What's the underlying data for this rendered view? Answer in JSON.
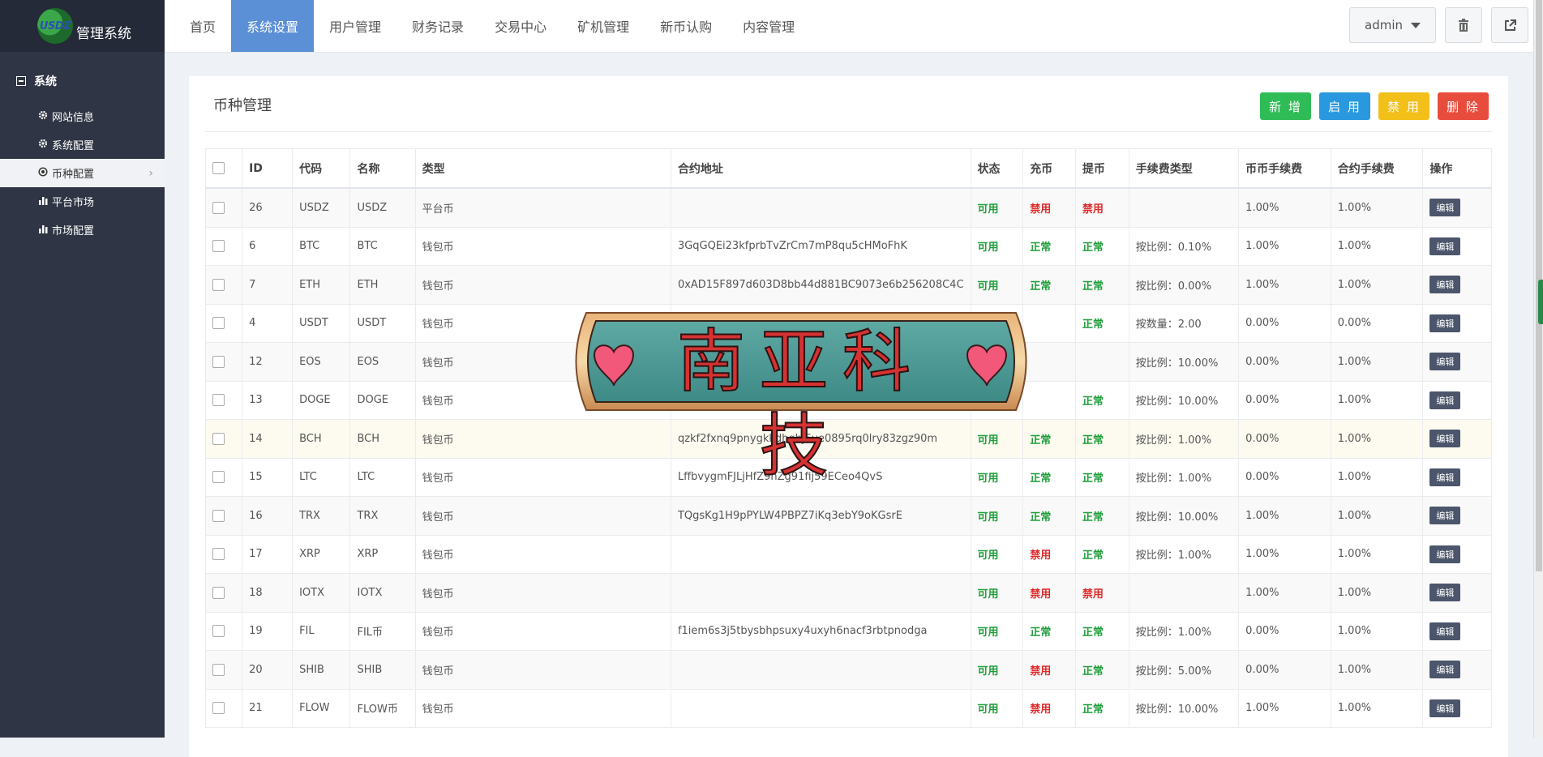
{
  "brand": {
    "logo_text": "USDZ",
    "title": "管理系统"
  },
  "sidebar": {
    "group": "系统",
    "items": [
      {
        "label": "网站信息",
        "icon": "gear-icon"
      },
      {
        "label": "系统配置",
        "icon": "gear-icon"
      },
      {
        "label": "币种配置",
        "icon": "dot-circle-icon",
        "active": true
      },
      {
        "label": "平台市场",
        "icon": "bar-chart-icon"
      },
      {
        "label": "市场配置",
        "icon": "bar-chart-icon"
      }
    ]
  },
  "nav": [
    "首页",
    "系统设置",
    "用户管理",
    "财务记录",
    "交易中心",
    "矿机管理",
    "新币认购",
    "内容管理"
  ],
  "nav_active": "系统设置",
  "header": {
    "user": "admin"
  },
  "panel": {
    "title": "币种管理",
    "actions": [
      "新 增",
      "启 用",
      "禁 用",
      "删 除"
    ]
  },
  "table": {
    "columns": [
      "ID",
      "代码",
      "名称",
      "类型",
      "合约地址",
      "状态",
      "充币",
      "提币",
      "手续费类型",
      "币币手续费",
      "合约手续费",
      "操作"
    ],
    "edit_label": "编辑",
    "rows": [
      [
        "26",
        "USDZ",
        "USDZ",
        "平台币",
        "",
        "可用",
        "禁用",
        "禁用",
        "",
        "1.00%",
        "1.00%"
      ],
      [
        "6",
        "BTC",
        "BTC",
        "钱包币",
        "3GqGQEi23kfprbTvZrCm7mP8qu5cHMoFhK",
        "可用",
        "正常",
        "正常",
        "按比例：0.10%",
        "1.00%",
        "1.00%"
      ],
      [
        "7",
        "ETH",
        "ETH",
        "钱包币",
        "0xAD15F897d603D8bb44d881BC9073e6b256208C4C",
        "可用",
        "正常",
        "正常",
        "按比例：0.00%",
        "1.00%",
        "1.00%"
      ],
      [
        "4",
        "USDT",
        "USDT",
        "钱包币",
        "TQgsKg1H9",
        "",
        "",
        "正常",
        "按数量：2.00",
        "0.00%",
        "0.00%"
      ],
      [
        "12",
        "EOS",
        "EOS",
        "钱包币",
        "",
        "",
        "",
        "",
        "按比例：10.00%",
        "0.00%",
        "1.00%"
      ],
      [
        "13",
        "DOGE",
        "DOGE",
        "钱包币",
        "",
        "",
        "",
        "正常",
        "按比例：10.00%",
        "0.00%",
        "1.00%"
      ],
      [
        "14",
        "BCH",
        "BCH",
        "钱包币",
        "qzkf2fxnq9pnygkkdhqhj6ue0895rq0lry83zgz90m",
        "可用",
        "正常",
        "正常",
        "按比例：1.00%",
        "0.00%",
        "1.00%"
      ],
      [
        "15",
        "LTC",
        "LTC",
        "钱包币",
        "LffbvygmFJLjHfZ9nZg91fij59ECeo4QvS",
        "可用",
        "正常",
        "正常",
        "按比例：1.00%",
        "0.00%",
        "1.00%"
      ],
      [
        "16",
        "TRX",
        "TRX",
        "钱包币",
        "TQgsKg1H9pPYLW4PBPZ7iKq3ebY9oKGsrE",
        "可用",
        "正常",
        "正常",
        "按比例：10.00%",
        "1.00%",
        "1.00%"
      ],
      [
        "17",
        "XRP",
        "XRP",
        "钱包币",
        "",
        "可用",
        "禁用",
        "正常",
        "按比例：1.00%",
        "1.00%",
        "1.00%"
      ],
      [
        "18",
        "IOTX",
        "IOTX",
        "钱包币",
        "",
        "可用",
        "禁用",
        "禁用",
        "",
        "1.00%",
        "1.00%"
      ],
      [
        "19",
        "FIL",
        "FIL币",
        "钱包币",
        "f1iem6s3j5tbysbhpsuxy4uxyh6nacf3rbtpnodga",
        "可用",
        "正常",
        "正常",
        "按比例：1.00%",
        "0.00%",
        "1.00%"
      ],
      [
        "20",
        "SHIB",
        "SHIB",
        "钱包币",
        "",
        "可用",
        "禁用",
        "正常",
        "按比例：5.00%",
        "0.00%",
        "1.00%"
      ],
      [
        "21",
        "FLOW",
        "FLOW币",
        "钱包币",
        "",
        "可用",
        "禁用",
        "正常",
        "按比例：10.00%",
        "1.00%",
        "1.00%"
      ]
    ]
  },
  "watermark": {
    "text": "南亚科技"
  },
  "colors": {
    "nav_active": "#5b8fd6",
    "ok": "#1f9e3a",
    "bad": "#e02b2b"
  }
}
